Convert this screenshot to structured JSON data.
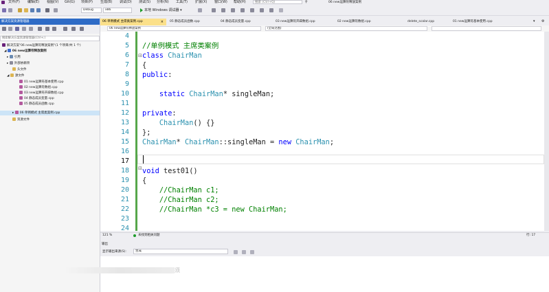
{
  "menu": [
    "文件(F)",
    "编辑(E)",
    "视图(V)",
    "Git(G)",
    "项目(P)",
    "生成(B)",
    "调试(D)",
    "测试(S)",
    "分析(N)",
    "工具(T)",
    "扩展(X)",
    "窗口(W)",
    "帮助(H)"
  ],
  "search_placeholder": "搜索 (Ctrl+Q)",
  "window_title": "06 new运算符释放案例",
  "toolbar": {
    "config": "Debug",
    "platform": "x86",
    "run_label": "本地 Windows 调试器",
    "run_dropdown": "▾"
  },
  "solution_explorer": {
    "title": "解决方案资源管理器",
    "search_placeholder": "搜索解决方案资源管理器(Ctrl+;)",
    "items": [
      "解决方案\"06 new运算符释放案例\"(1 个项目/共 1 个)",
      "06 new运算符释放案例",
      "引用",
      "外部依赖项",
      "头文件",
      "源文件",
      "01 new运算符基本使用.cpp",
      "02 new运算符数组.cpp",
      "03 new运算符开辟数组.cpp",
      "04 静态成员变量.cpp",
      "05 静态成员函数.cpp",
      "06 单例模式 主席类案例.cpp",
      "资源文件"
    ]
  },
  "tabs": [
    {
      "label": "06 单例模式 主席类案例.cpp",
      "active": true
    },
    {
      "label": "05 静态成员函数.cpp",
      "active": false
    },
    {
      "label": "04 静态成员变量.cpp",
      "active": false
    },
    {
      "label": "03 new运算符开辟数组.cpp",
      "active": false
    },
    {
      "label": "02 new运算符数组.cpp",
      "active": false
    },
    {
      "label": "delete_scalar.cpp",
      "active": false
    },
    {
      "label": "01 new运算符基本使用.cpp",
      "active": false
    }
  ],
  "nav": {
    "project": "06 new运算符释放案例",
    "scope": "(全局范围)"
  },
  "editor": {
    "line_numbers": [
      "4",
      "5",
      "6",
      "7",
      "8",
      "9",
      "10",
      "11",
      "12",
      "13",
      "14",
      "15",
      "16",
      "17",
      "18",
      "19",
      "20",
      "21",
      "22",
      "23",
      "24"
    ],
    "lines": [
      "",
      "//单例模式 主席类案例",
      "class ChairMan",
      "{",
      "public:",
      "",
      "    static ChairMan* singleMan;",
      "",
      "private:",
      "    ChairMan() {}",
      "};",
      "ChairMan* ChairMan::singleMan = new ChairMan;",
      "",
      "",
      "void test01()",
      "{",
      "    //ChairMan c1;",
      "    //ChairMan c2;",
      "    //ChairMan *c3 = new ChairMan;",
      "",
      ""
    ],
    "current_line": "17"
  },
  "status": {
    "zoom": "121 %",
    "issues": "未找到相关问题",
    "pos": "行: 17"
  },
  "output": {
    "title": "输出",
    "source_label": "显示输出来源(S):",
    "source_value": "生成",
    "watermark_char": "须"
  },
  "colors": {
    "accent": "#2e6bc6",
    "active_tab": "#fbe08a",
    "keyword": "#0000ff",
    "type": "#2b91af",
    "comment": "#008000",
    "change_bar": "#57a64a"
  }
}
